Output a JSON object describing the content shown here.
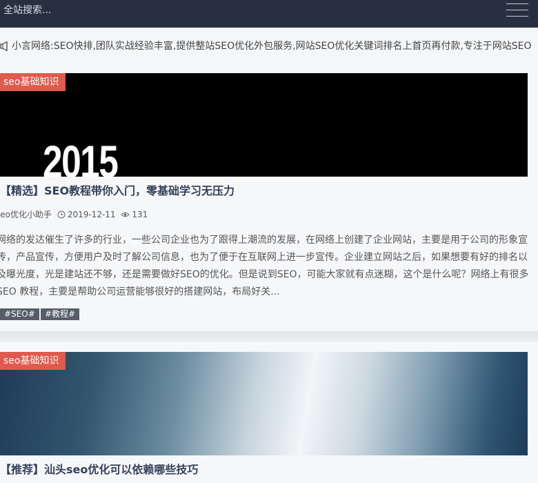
{
  "header": {
    "search_placeholder": "全站搜索...",
    "menu_icon": "hamburger-menu-icon",
    "background": "#263040"
  },
  "notice": {
    "icon": "megaphone-icon",
    "text": "小言网络:SEO快排,团队实战经验丰富,提供整站SEO优化外包服务,网站SEO优化关键词排名上首页再付款,专注于网站SEO"
  },
  "posts": [
    {
      "category": "seo基础知识",
      "thumbnail_text": "2015",
      "title": "【精选】SEO教程带你入门，零基础学习无压力",
      "author": "seo优化小助手",
      "date": "2019-12-11",
      "views": "131",
      "excerpt": "网络的发达催生了许多的行业，一些公司企业也为了跟得上潮流的发展，在网络上创建了企业网站，主要是用于公司的形象宣传，产品宣传，方便用户及时了解公司信息，也为了便于在互联网上进一步宣传。企业建立网站之后，如果想要有好的排名以及曝光度，光是建站还不够，还是需要做好SEO的优化。但是说到SEO，可能大家就有点迷糊，这个是什么呢？网络上有很多SEO 教程，主要是帮助公司运营能够很好的搭建网站，布局好关...",
      "tags": [
        "#SEO#",
        "#教程#"
      ]
    },
    {
      "category": "seo基础知识",
      "title": "【推荐】汕头seo优化可以依赖哪些技巧"
    }
  ],
  "colors": {
    "badge": "#e05a4e",
    "tag": "#545d68",
    "title": "#33415a"
  }
}
